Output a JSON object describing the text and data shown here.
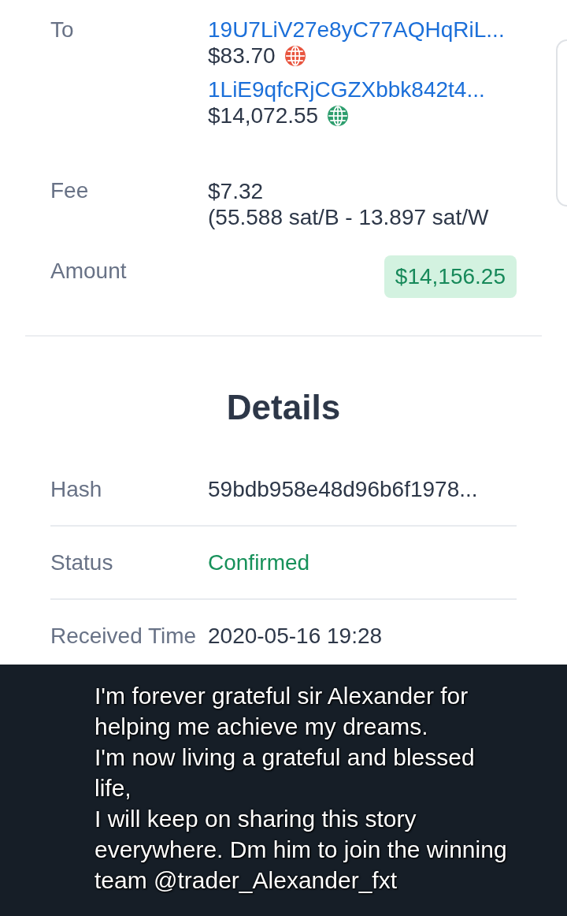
{
  "outputs": {
    "label": "To",
    "items": [
      {
        "address": "19U7LiV27e8yC77AQHqRiL...",
        "amount": "$83.70",
        "color": "#e8553f"
      },
      {
        "address": "1LiE9qfcRjCGZXbbk842t4...",
        "amount": "$14,072.55",
        "color": "#2e9e6e"
      }
    ]
  },
  "fee": {
    "label": "Fee",
    "value": "$7.32",
    "rate": "(55.588 sat/B - 13.897 sat/W"
  },
  "amount": {
    "label": "Amount",
    "value": "$14,156.25"
  },
  "details": {
    "title": "Details",
    "rows": [
      {
        "label": "Hash",
        "value": "59bdb958e48d96b6f1978...",
        "kind": "text"
      },
      {
        "label": "Status",
        "value": "Confirmed",
        "kind": "status"
      },
      {
        "label": "Received Time",
        "value": "2020-05-16 19:28",
        "kind": "text"
      }
    ]
  },
  "caption": {
    "text": "I'm forever grateful sir Alexander for\nhelping me achieve my dreams.\nI'm now living a grateful and blessed\nlife,\nI will keep on sharing this story\neverywhere. Dm him to join the winning\nteam @trader_Alexander_fxt"
  }
}
